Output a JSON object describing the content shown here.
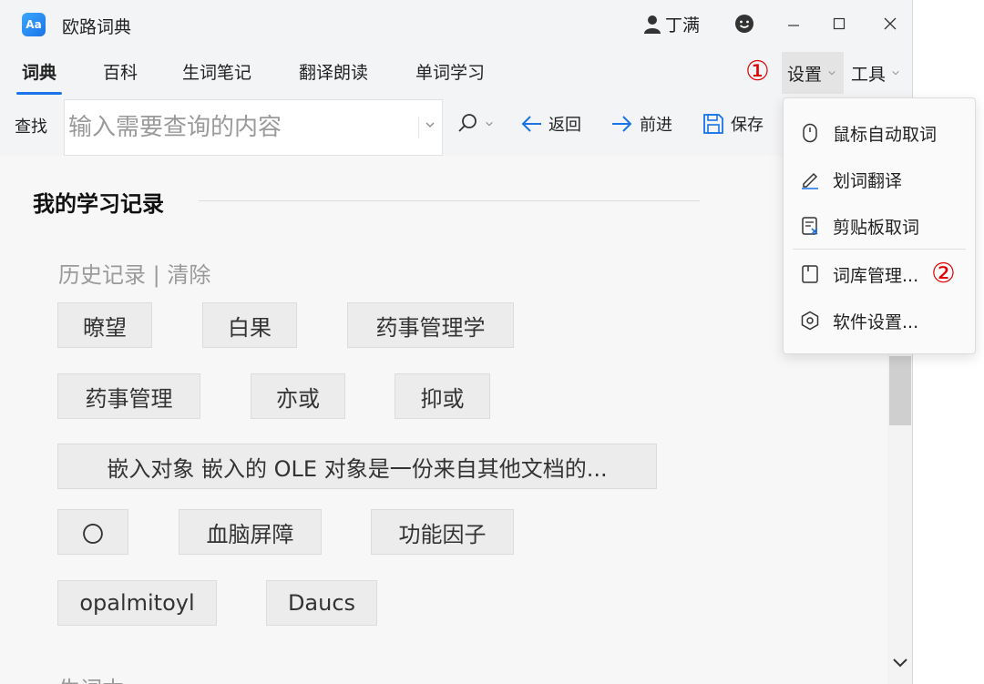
{
  "app": {
    "title": "欧路词典",
    "icon_text": "Aa"
  },
  "titlebar": {
    "user_name": "丁满"
  },
  "tabs": [
    {
      "label": "词典",
      "active": true
    },
    {
      "label": "百科"
    },
    {
      "label": "生词笔记"
    },
    {
      "label": "翻译朗读"
    },
    {
      "label": "单词学习"
    }
  ],
  "top_menu": {
    "settings": "设置",
    "tools": "工具"
  },
  "annotations": {
    "one": "①",
    "two": "②"
  },
  "toolbar": {
    "find_label": "查找",
    "search_placeholder": "输入需要查询的内容",
    "back": "返回",
    "forward": "前进",
    "save": "保存"
  },
  "study": {
    "title": "我的学习记录",
    "history_header": "历史记录 | 清除",
    "next_header": "生词本",
    "history": [
      "暸望",
      "白果",
      "药事管理学",
      "药事管理",
      "亦或",
      "抑或",
      "嵌入对象 嵌入的 OLE 对象是一份来自其他文档的...",
      "〇",
      "血脑屏障",
      "功能因子",
      "opalmitoyl",
      "Daucs"
    ]
  },
  "settings_menu": {
    "items": [
      {
        "label": "鼠标自动取词",
        "icon": "mouse-icon"
      },
      {
        "label": "划词翻译",
        "icon": "pen-icon"
      },
      {
        "label": "剪贴板取词",
        "icon": "clipboard-icon"
      },
      {
        "label": "词库管理...",
        "icon": "book-icon"
      },
      {
        "label": "软件设置...",
        "icon": "gear-icon"
      }
    ]
  },
  "colors": {
    "accent": "#1a73e8",
    "annotation": "#e00000"
  }
}
